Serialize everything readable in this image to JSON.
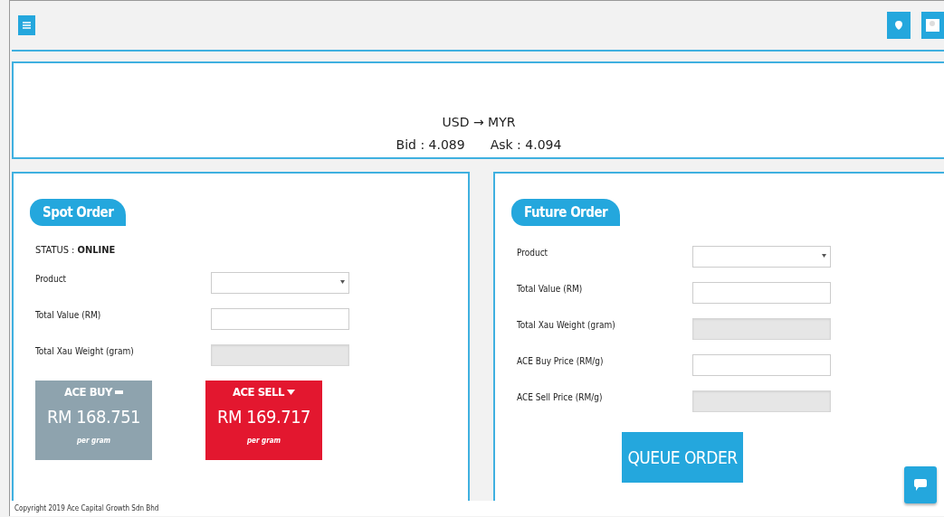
{
  "rate": {
    "pair": "USD → MYR",
    "bid": "Bid : 4.089",
    "ask": "Ask : 4.094"
  },
  "spot": {
    "title": "Spot Order",
    "status_label": "STATUS : ",
    "status": "ONLINE",
    "fields": [
      {
        "label": "Product",
        "kind": "select",
        "disabled": false
      },
      {
        "label": "Total Value (RM)",
        "kind": "input",
        "disabled": false
      },
      {
        "label": "Total Xau Weight (gram)",
        "kind": "input",
        "disabled": true
      }
    ],
    "prices": [
      {
        "label": "ACE BUY",
        "kind": "buy",
        "price": "RM 168.751",
        "unit": "per gram",
        "color": "#8ea3ae"
      },
      {
        "label": "ACE SELL",
        "kind": "sell",
        "price": "RM 169.717",
        "unit": "per gram",
        "color": "#e3172f"
      }
    ]
  },
  "future": {
    "title": "Future Order",
    "fields": [
      {
        "label": "Product",
        "kind": "select",
        "disabled": false
      },
      {
        "label": "Total Value (RM)",
        "kind": "input",
        "disabled": false
      },
      {
        "label": "Total Xau Weight (gram)",
        "kind": "input",
        "disabled": true
      },
      {
        "label": "ACE Buy Price (RM/g)",
        "kind": "input",
        "disabled": false
      },
      {
        "label": "ACE Sell Price (RM/g)",
        "kind": "input",
        "disabled": true
      }
    ],
    "button": "QUEUE ORDER"
  },
  "footer": "Copyright 2019 Ace Capital Growth Sdn Bhd"
}
